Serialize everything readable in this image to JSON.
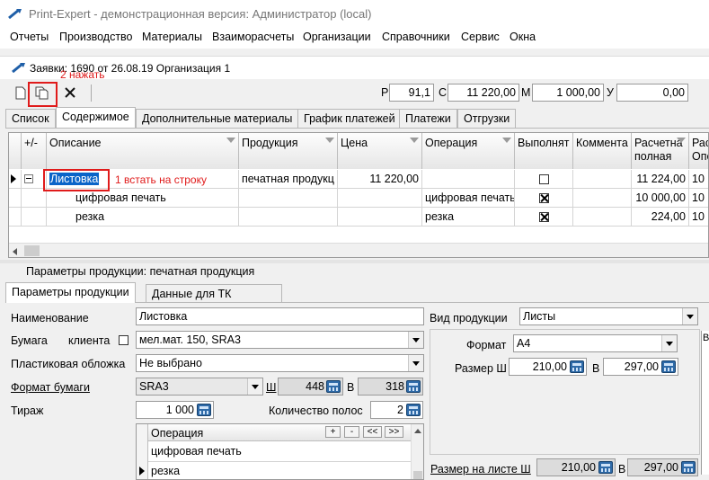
{
  "window": {
    "title": "Print-Expert - демонстрационная версия: Администратор (local)"
  },
  "menu": [
    "Отчеты",
    "Производство",
    "Материалы",
    "Взаиморасчеты",
    "Организации",
    "Справочники",
    "Сервис",
    "Окна"
  ],
  "doc": {
    "title": "Заявки: 1690 от 26.08.19  Организация 1"
  },
  "toolbar": {
    "annotation": "2 нажать",
    "fields": [
      {
        "label": "Р",
        "value": "91,1"
      },
      {
        "label": "С",
        "value": "11 220,00"
      },
      {
        "label": "М",
        "value": "1 000,00"
      },
      {
        "label": "У",
        "value": "0,00"
      }
    ]
  },
  "tabs": [
    "Список",
    "Содержимое",
    "Дополнительные материалы",
    "График платежей",
    "Платежи",
    "Отгрузки"
  ],
  "active_tab": "Содержимое",
  "grid": {
    "columns": [
      "+/-",
      "Описание",
      "Продукция",
      "Цена",
      "Операция",
      "Выполнят",
      "Коммента",
      "Расчетна\nполная",
      "Рас\nОпе"
    ],
    "rows": [
      {
        "desc": "Листовка",
        "prod": "печатная продукц",
        "price": "11 220,00",
        "op": "",
        "done": false,
        "calc": "11 224,00",
        "extra": "10"
      },
      {
        "desc": "цифровая печать",
        "prod": "",
        "price": "",
        "op": "цифровая печать",
        "done": true,
        "calc": "10 000,00",
        "extra": "10"
      },
      {
        "desc": "резка",
        "prod": "",
        "price": "",
        "op": "резка",
        "done": true,
        "calc": "224,00",
        "extra": "10"
      }
    ],
    "annotation": "1 встать на строку"
  },
  "params": {
    "header": "Параметры продукции: печатная продукция",
    "tabs": [
      "Параметры продукции",
      "Данные для ТК"
    ],
    "name_label": "Наименование",
    "name_value": "Листовка",
    "paper_label": "Бумага",
    "client_label": "клиента",
    "paper_value": "мел.мат. 150, SRA3",
    "plastic_label": "Пластиковая обложка",
    "plastic_value": "Не выбрано",
    "format_label": "Формат бумаги",
    "format_value": "SRA3",
    "w_label": "Ш",
    "w_value": "448",
    "h_label": "В",
    "h_value": "318",
    "run_label": "Тираж",
    "run_value": "1 000",
    "pages_label": "Количество полос",
    "pages_value": "2",
    "ops_header": "Операция",
    "ops_buttons": [
      "+",
      "-",
      "<<",
      ">>"
    ],
    "ops": [
      "цифровая печать",
      "резка"
    ],
    "kind_label": "Вид продукции",
    "kind_value": "Листы",
    "fmt_label": "Формат",
    "fmt_value": "А4",
    "size_label": "Размер Ш",
    "size_w": "210,00",
    "size_h_label": "В",
    "size_h": "297,00",
    "sheet_label": "Размер на листе Ш",
    "sheet_w": "210,00",
    "sheet_h_label": "В",
    "sheet_h": "297,00",
    "right_edge_label": "В"
  }
}
